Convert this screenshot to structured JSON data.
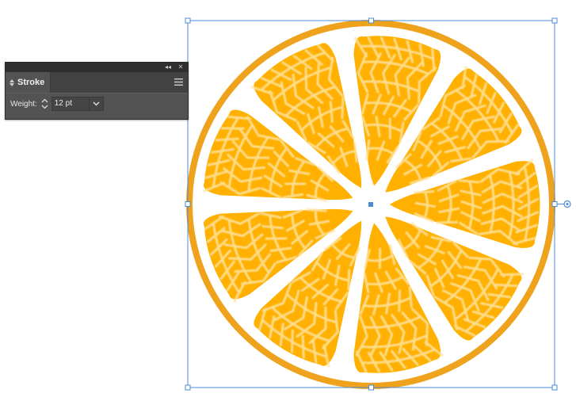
{
  "panel": {
    "tab_label": "Stroke",
    "weight_label": "Weight:",
    "weight_value": "12 pt",
    "icons": {
      "collapse": "double-chevron-left-icon",
      "close": "close-icon",
      "menu": "hamburger-menu-icon",
      "stepper": "up-down-stepper-icon",
      "dropdown": "chevron-down-icon"
    }
  },
  "artwork": {
    "subject": "orange-slice",
    "segments": 9,
    "colors": {
      "rind": "#EFA21C",
      "pith": "#FFFFFF",
      "segment": "#FFB000",
      "vein": "#FFE4A3",
      "selection": "#4A8BD8"
    }
  }
}
